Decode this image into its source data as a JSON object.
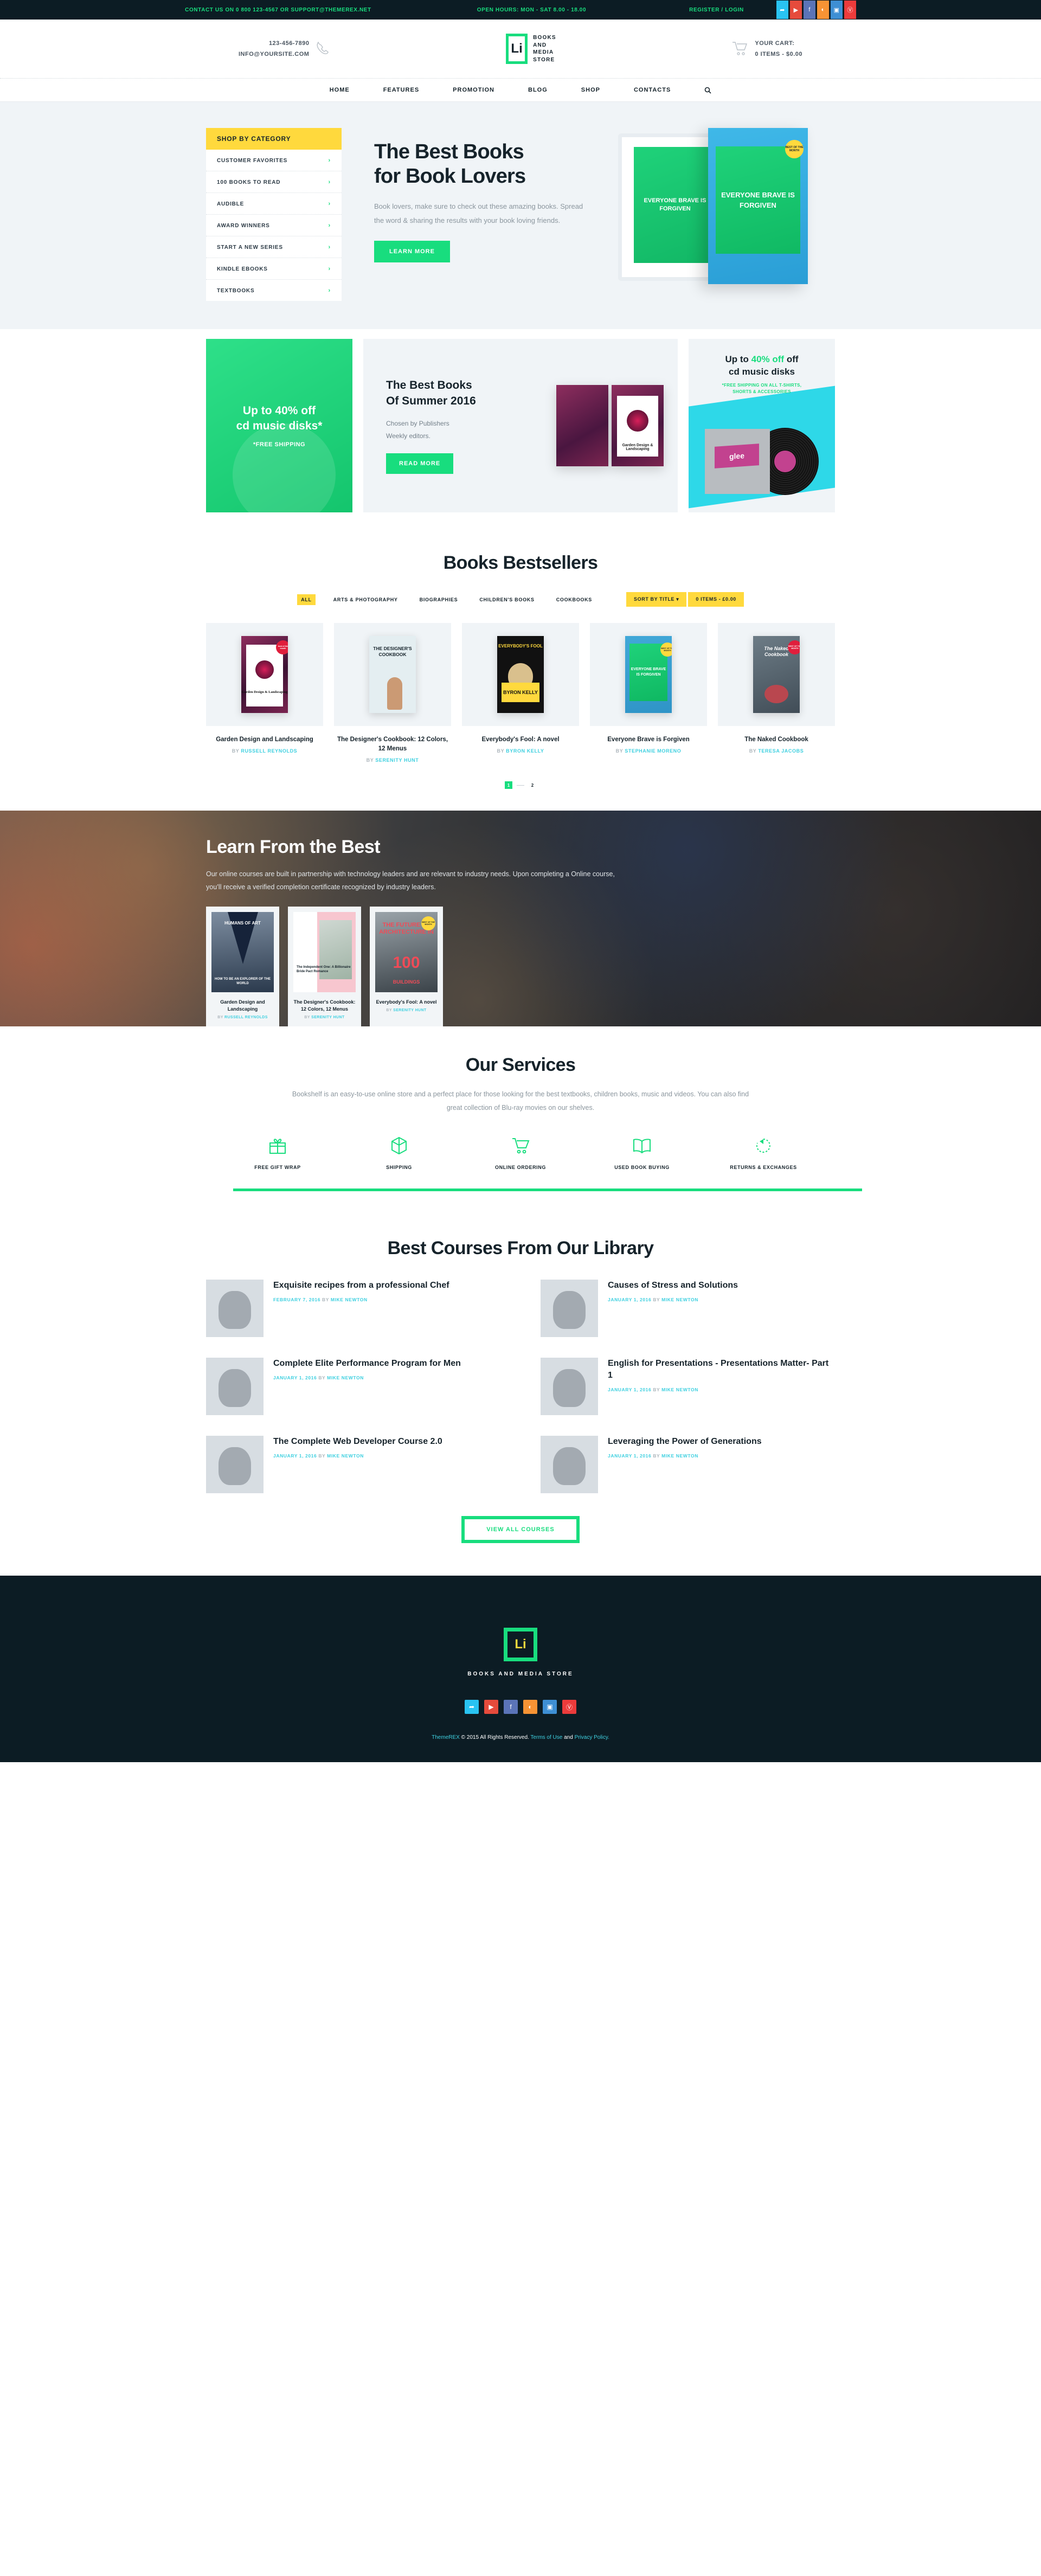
{
  "topbar": {
    "contact": "CONTACT US ON 0 800 123-4567 OR SUPPORT@THEMEREX.NET",
    "hours": "OPEN HOURS: MON - SAT 8.00 - 18.00",
    "register": "REGISTER / LOGIN",
    "socials": [
      {
        "name": "twitter-icon",
        "glyph": "⚑",
        "color": "#29c3f2"
      },
      {
        "name": "youtube-icon",
        "glyph": "▶",
        "color": "#e64b3c"
      },
      {
        "name": "facebook-icon",
        "glyph": "f",
        "color": "#5b74b8"
      },
      {
        "name": "rss-icon",
        "glyph": "◔",
        "color": "#f79334"
      },
      {
        "name": "instagram-icon",
        "glyph": "▣",
        "color": "#3e8fd4"
      },
      {
        "name": "pinterest-icon",
        "glyph": "Ⓟ",
        "color": "#ec3b3b"
      }
    ]
  },
  "header": {
    "phone": "123-456-7890",
    "email": "INFO@YOURSITE.COM",
    "logo_letters": "Li",
    "logo_line1": "BOOKS",
    "logo_line2": "AND",
    "logo_line3": "MEDIA",
    "logo_line4": "STORE",
    "cart_label": "YOUR CART:",
    "cart_value": "0 ITEMS - $0.00"
  },
  "nav": {
    "items": [
      "HOME",
      "FEATURES",
      "PROMOTION",
      "BLOG",
      "SHOP",
      "CONTACTS"
    ],
    "search_icon": "search-icon"
  },
  "hero": {
    "category_title": "SHOP BY CATEGORY",
    "categories": [
      "CUSTOMER FAVORITES",
      "100 BOOKS TO READ",
      "AUDIBLE",
      "AWARD WINNERS",
      "START A NEW SERIES",
      "KINDLE EBOOKS",
      "TEXTBOOKS"
    ],
    "title_line1": "The Best Books",
    "title_line2": "for Book Lovers",
    "description": "Book lovers, make sure to check out these amazing books. Spread the word & sharing the results with your book loving friends.",
    "cta": "LEARN MORE",
    "tablet_cover": "EVERYONE BRAVE IS FORGIVEN",
    "book_cover": "EVERYONE BRAVE IS FORGIVEN",
    "book_badge": "BEST OF THE MONTH"
  },
  "promos": {
    "a": {
      "title_line1": "Up to 40% off",
      "title_line2": "cd music disks*",
      "sub": "*FREE SHIPPING"
    },
    "b": {
      "title_line1": "The Best Books",
      "title_line2": "Of Summer 2016",
      "desc_line1": "Chosen by Publishers",
      "desc_line2": "Weekly editors.",
      "cta": "READ MORE",
      "book_caption": "Garden Design & Landscaping"
    },
    "c": {
      "title_pre": "Up to ",
      "title_pct": "40% off",
      "title_post": "",
      "title_line2": "cd music disks",
      "sub_line1": "*FREE SHIPPING ON ALL T-SHIRTS,",
      "sub_line2": "SHORTS & ACCESSORIES",
      "album": "glee"
    }
  },
  "bestsellers": {
    "title": "Books Bestsellers",
    "filters": [
      "ALL",
      "ARTS & PHOTOGRAPHY",
      "BIOGRAPHIES",
      "CHILDREN'S BOOKS",
      "COOKBOOKS"
    ],
    "active_filter": "ALL",
    "sort_label": "SORT BY TITLE",
    "cart_label": "0 ITEMS - £0.00",
    "products": [
      {
        "title": "Garden Design and Landscaping",
        "by": "BY ",
        "author": "RUSSELL REYNOLDS",
        "badge": "best of the month",
        "badge_type": "red"
      },
      {
        "title": "The Designer's Cookbook: 12 Colors, 12 Menus",
        "by": "BY ",
        "author": "SERENITY HUNT",
        "badge": "",
        "badge_type": "none"
      },
      {
        "title": "Everybody's Fool: A novel",
        "by": "BY ",
        "author": "BYRON KELLY",
        "badge": "",
        "badge_type": "none"
      },
      {
        "title": "Everyone Brave is Forgiven",
        "by": "BY ",
        "author": "STEPHANIE MORENO",
        "badge": "BEST OF THE MONTH",
        "badge_type": "yel"
      },
      {
        "title": "The Naked Cookbook",
        "by": "BY ",
        "author": "TERESA JACOBS",
        "badge": "BEST OF THE MONTH",
        "badge_type": "red"
      }
    ],
    "cover_texts": {
      "designers": "THE DESIGNER'S COOKBOOK",
      "fool_top": "EVERYBODY'S FOOL",
      "fool_band": "BYRON KELLY",
      "brave": "EVERYONE BRAVE IS FORGIVEN",
      "naked": "The Naked Cookbook",
      "garden": "Garden Design & Landscaping"
    },
    "pages": [
      "1",
      "2"
    ],
    "active_page": "1"
  },
  "learn": {
    "title": "Learn From the Best",
    "description": "Our online courses are built in partnership with technology leaders and are relevant to industry needs. Upon completing a Online course, you’ll receive a verified completion certificate recognized by industry leaders.",
    "cards": [
      {
        "title": "Garden Design and Landscaping",
        "by": "BY ",
        "author": "RUSSELL REYNOLDS",
        "cover_top": "HUMANS OF ART",
        "cover_bottom": "HOW TO BE AN EXPLORER OF THE WORLD"
      },
      {
        "title": "The Designer's Cookbook: 12 Colors, 12 Menus",
        "by": "BY ",
        "author": "SERENITY HUNT",
        "cover_top": "The Independent One: A Billionaire Bride Pact Romance",
        "cover_bottom": ""
      },
      {
        "title": "Everybody's Fool: A novel",
        "by": "BY ",
        "author": "SERENITY HUNT",
        "cover_top": "THE FUTURE OF ARCHITECTURE IN",
        "cover_mid": "100",
        "cover_bottom": "BUILDINGS"
      }
    ]
  },
  "services": {
    "title": "Our Services",
    "description": "Bookshelf is an easy-to-use online store and a perfect place for those looking for the best textbooks, children books, music and videos. You can also find great collection of Blu-ray movies on our shelves.",
    "items": [
      {
        "label": "FREE GIFT WRAP",
        "icon": "gift-icon"
      },
      {
        "label": "SHIPPING",
        "icon": "box-icon"
      },
      {
        "label": "ONLINE ORDERING",
        "icon": "cart-icon"
      },
      {
        "label": "USED BOOK BUYING",
        "icon": "open-book-icon"
      },
      {
        "label": "RETURNS & EXCHANGES",
        "icon": "return-arrow-icon"
      }
    ]
  },
  "courses": {
    "title": "Best Courses From Our Library",
    "items": [
      {
        "title": "Exquisite recipes from a professional Chef",
        "date": "FEBRUARY 7, 2016",
        "by": "BY",
        "author": "MIKE NEWTON"
      },
      {
        "title": "Causes of Stress and Solutions",
        "date": "JANUARY 1, 2016",
        "by": "BY",
        "author": "MIKE NEWTON"
      },
      {
        "title": "Complete Elite Performance Program for Men",
        "date": "JANUARY 1, 2016",
        "by": "BY",
        "author": "MIKE NEWTON"
      },
      {
        "title": "English for Presentations - Presentations Matter- Part 1",
        "date": "JANUARY 1, 2016",
        "by": "BY",
        "author": "MIKE NEWTON"
      },
      {
        "title": "The Complete Web Developer Course 2.0",
        "date": "JANUARY 1, 2016",
        "by": "BY",
        "author": "MIKE NEWTON"
      },
      {
        "title": "Leveraging the Power of Generations",
        "date": "JANUARY 1, 2016",
        "by": "BY",
        "author": "MIKE NEWTON"
      }
    ],
    "cta": "VIEW ALL COURSES"
  },
  "footer": {
    "logo_letters": "Li",
    "name": "BOOKS AND MEDIA STORE",
    "socials": [
      {
        "name": "twitter-icon",
        "glyph": "⚑",
        "color": "#29c3f2"
      },
      {
        "name": "youtube-icon",
        "glyph": "▶",
        "color": "#e64b3c"
      },
      {
        "name": "facebook-icon",
        "glyph": "f",
        "color": "#5b74b8"
      },
      {
        "name": "rss-icon",
        "glyph": "◔",
        "color": "#f79334"
      },
      {
        "name": "instagram-icon",
        "glyph": "▣",
        "color": "#3e8fd4"
      },
      {
        "name": "pinterest-icon",
        "glyph": "Ⓟ",
        "color": "#ec3b3b"
      }
    ],
    "copy_brand": "ThemeREX",
    "copy_text": " © 2015 All Rights Reserved. ",
    "terms": "Terms of Use",
    "and": " and ",
    "privacy": "Privacy Policy."
  },
  "colors": {
    "green": "#18dd7e",
    "yellow": "#ffd93d",
    "dark": "#0c1c24",
    "cyan": "#3fd0e0"
  }
}
